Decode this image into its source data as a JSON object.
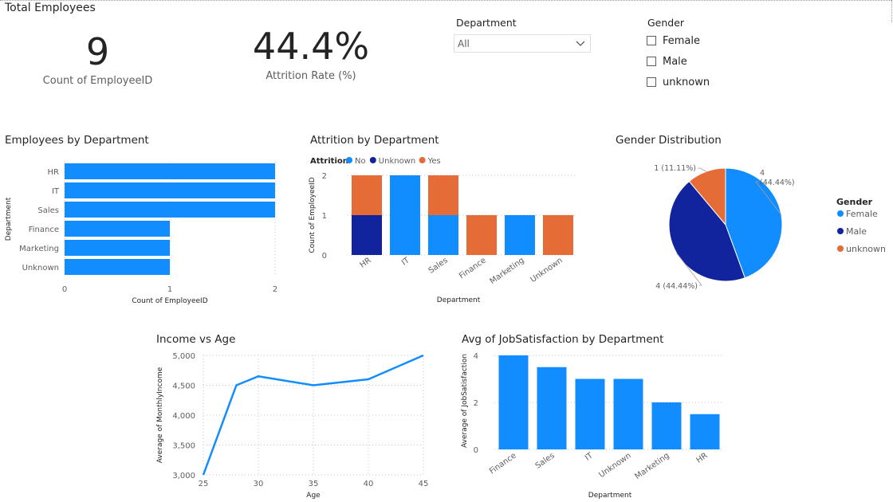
{
  "page": {
    "card_title": "Total Employees"
  },
  "kpis": [
    {
      "value": "9",
      "label": "Count of EmployeeID"
    },
    {
      "value": "44.4%",
      "label": "Attrition Rate (%)"
    }
  ],
  "slicers": {
    "department": {
      "header": "Department",
      "selected": "All"
    },
    "gender": {
      "header": "Gender",
      "options": [
        "Female",
        "Male",
        "unknown"
      ]
    }
  },
  "colors": {
    "blue": "#118DFF",
    "dark_blue": "#12239E",
    "orange": "#E66C37",
    "axis_text": "#605E5C",
    "grid": "#C8C6C4"
  },
  "chart_data": [
    {
      "id": "employees_by_department",
      "type": "bar",
      "orientation": "horizontal",
      "title": "Employees by Department",
      "categories": [
        "HR",
        "IT",
        "Sales",
        "Finance",
        "Marketing",
        "Unknown"
      ],
      "values": [
        2,
        2,
        2,
        1,
        1,
        1
      ],
      "xlabel": "Count of EmployeeID",
      "ylabel": "Department",
      "xticks": [
        "0",
        "1",
        "2"
      ],
      "xlim": [
        0,
        2
      ],
      "grid": true
    },
    {
      "id": "attrition_by_department",
      "type": "bar",
      "stacked": true,
      "title": "Attrition by Department",
      "legend_title": "Attrition",
      "categories": [
        "HR",
        "IT",
        "Sales",
        "Finance",
        "Marketing",
        "Unknown"
      ],
      "series": [
        {
          "name": "No",
          "values": [
            0,
            2,
            1,
            0,
            1,
            0
          ]
        },
        {
          "name": "Unknown",
          "values": [
            1,
            0,
            0,
            0,
            0,
            0
          ]
        },
        {
          "name": "Yes",
          "values": [
            1,
            0,
            1,
            1,
            0,
            1
          ]
        }
      ],
      "xlabel": "Department",
      "ylabel": "Count of EmployeeID",
      "yticks": [
        "0",
        "1",
        "2"
      ],
      "ylim": [
        0,
        2
      ],
      "legend_position": "top-left"
    },
    {
      "id": "gender_distribution",
      "type": "pie",
      "title": "Gender Distribution",
      "legend_title": "Gender",
      "series": [
        {
          "name": "Female",
          "value": 4,
          "label": "4 (44.44%)"
        },
        {
          "name": "Male",
          "value": 4,
          "label": "4 (44.44%)"
        },
        {
          "name": "unknown",
          "value": 1,
          "label": "1 (11.11%)"
        }
      ],
      "legend_position": "right"
    },
    {
      "id": "income_vs_age",
      "type": "line",
      "title": "Income vs Age",
      "x": [
        25,
        28,
        30,
        35,
        40,
        45
      ],
      "y": [
        3000,
        4500,
        4650,
        4500,
        4600,
        5000
      ],
      "xlabel": "Age",
      "ylabel": "Average of MonthlyIncome",
      "xticks": [
        "25",
        "30",
        "35",
        "40",
        "45"
      ],
      "yticks": [
        "3,000",
        "3,500",
        "4,000",
        "4,500",
        "5,000"
      ],
      "xlim": [
        25,
        45
      ],
      "ylim": [
        3000,
        5000
      ]
    },
    {
      "id": "avg_jobsatisfaction_by_department",
      "type": "bar",
      "title": "Avg of JobSatisfaction by Department",
      "categories": [
        "Finance",
        "Sales",
        "IT",
        "Unknown",
        "Marketing",
        "HR"
      ],
      "values": [
        4,
        3.5,
        3,
        3,
        2,
        1.5
      ],
      "xlabel": "Department",
      "ylabel": "Average of JobSatisfaction",
      "yticks": [
        "0",
        "2",
        "4"
      ],
      "ylim": [
        0,
        4
      ]
    }
  ]
}
